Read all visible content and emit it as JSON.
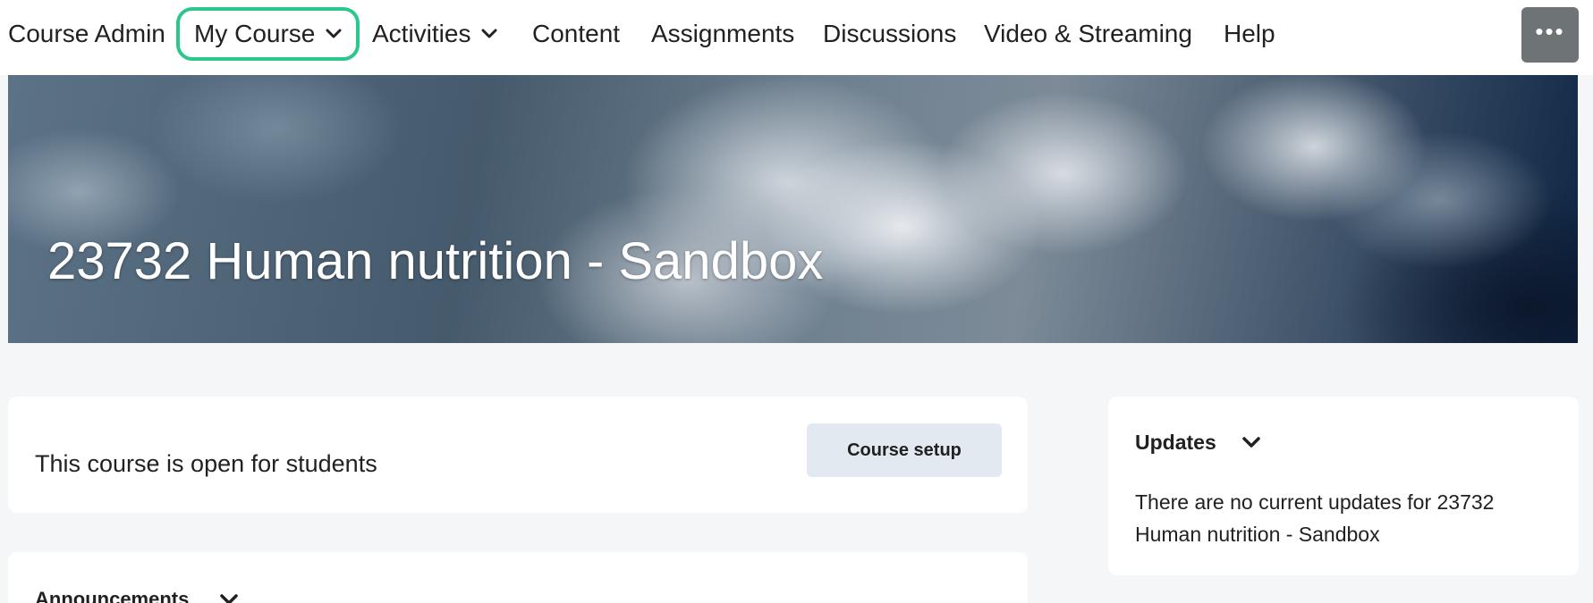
{
  "nav": {
    "items": [
      {
        "label": "Course Admin",
        "has_dropdown": false
      },
      {
        "label": "My Course",
        "has_dropdown": true,
        "active": true
      },
      {
        "label": "Activities",
        "has_dropdown": true
      },
      {
        "label": "Content",
        "has_dropdown": false
      },
      {
        "label": "Assignments",
        "has_dropdown": false
      },
      {
        "label": "Discussions",
        "has_dropdown": false
      },
      {
        "label": "Video & Streaming",
        "has_dropdown": false
      },
      {
        "label": "Help",
        "has_dropdown": false
      }
    ],
    "more_icon": "more-horizontal-icon",
    "active_color": "#2bc78c"
  },
  "banner": {
    "title": "23732 Human nutrition - Sandbox"
  },
  "status_card": {
    "text": "This course is open for students",
    "button_label": "Course setup"
  },
  "announcements": {
    "title": "Announcements"
  },
  "updates": {
    "title": "Updates",
    "message": "There are no current updates for 23732 Human nutrition - Sandbox"
  }
}
